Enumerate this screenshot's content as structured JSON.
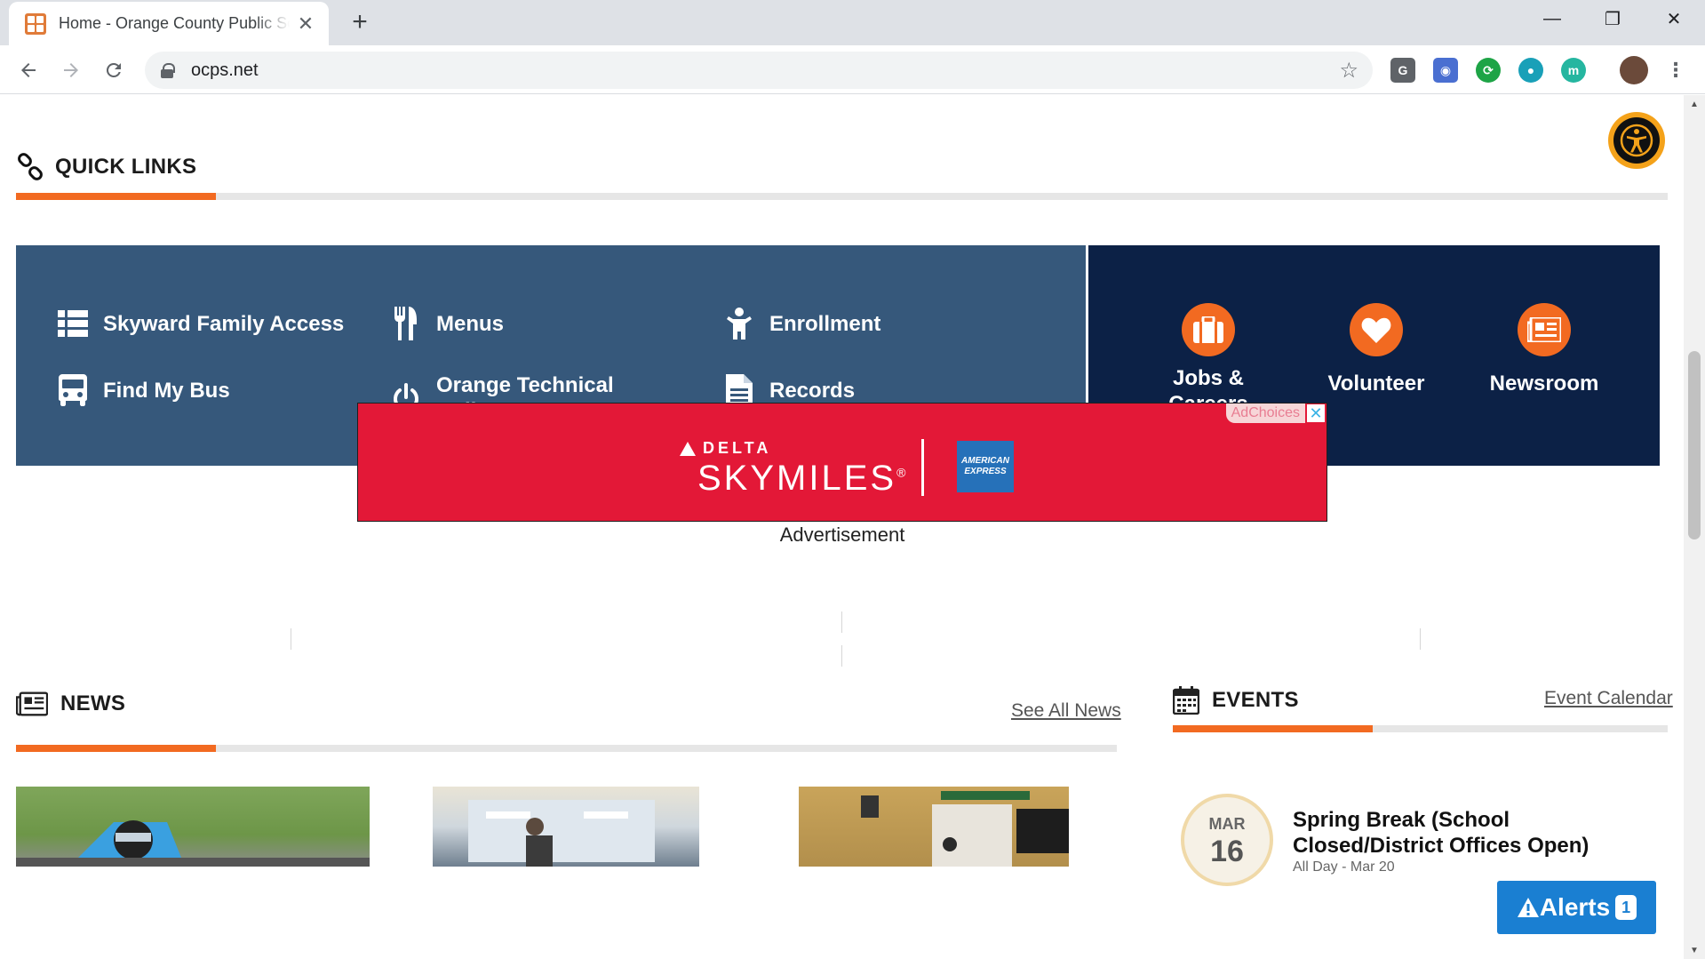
{
  "browser": {
    "tab_title": "Home - Orange County Public Schools",
    "tab_close": "✕",
    "new_tab": "+",
    "url": "ocps.net",
    "window": {
      "minimize": "—",
      "restore": "❐",
      "close": "✕"
    },
    "extensions": [
      {
        "name": "g-extension-icon",
        "glyph": "G",
        "color": "#5f6368"
      },
      {
        "name": "camera-extension-icon",
        "glyph": "◉",
        "color": "#4a6fd1"
      },
      {
        "name": "sync-extension-icon",
        "glyph": "⟳",
        "color": "#1ea446"
      },
      {
        "name": "ext-blocked-icon",
        "glyph": "●",
        "color": "#19a0b8"
      },
      {
        "name": "m-extension-icon",
        "glyph": "m",
        "color": "#25b6a0"
      }
    ]
  },
  "quick_links": {
    "title": "QUICK LINKS",
    "items": [
      {
        "label": "Skyward Family Access",
        "icon": "list-icon"
      },
      {
        "label": "Menus",
        "icon": "utensils-icon"
      },
      {
        "label": "Enrollment",
        "icon": "child-icon"
      },
      {
        "label": "Find My Bus",
        "icon": "bus-icon"
      },
      {
        "label": "Orange Technical College",
        "icon": "power-icon"
      },
      {
        "label": "Records",
        "icon": "document-icon"
      }
    ],
    "featured": [
      {
        "label": "Jobs & Careers",
        "icon": "briefcase-icon"
      },
      {
        "label": "Volunteer",
        "icon": "heart-icon"
      },
      {
        "label": "Newsroom",
        "icon": "newspaper-icon"
      }
    ]
  },
  "ad": {
    "adchoices": "AdChoices",
    "close": "✕",
    "brand": "DELTA",
    "product": "SKYMILES",
    "trademark": "®",
    "partner_line1": "AMERICAN",
    "partner_line2": "EXPRESS",
    "caption": "Advertisement"
  },
  "news": {
    "title": "NEWS",
    "see_all": "See All News"
  },
  "events": {
    "title": "EVENTS",
    "calendar_link": "Event Calendar",
    "items": [
      {
        "month": "MAR",
        "day": "16",
        "title": "Spring Break (School Closed/District Offices Open)",
        "sub": "All Day - Mar 20"
      }
    ]
  },
  "alerts": {
    "label": "Alerts",
    "count": "1"
  },
  "colors": {
    "accent": "#f26a21",
    "panel": "#36587b",
    "panel_dark": "#0c2146",
    "alerts": "#1a7fd2"
  }
}
